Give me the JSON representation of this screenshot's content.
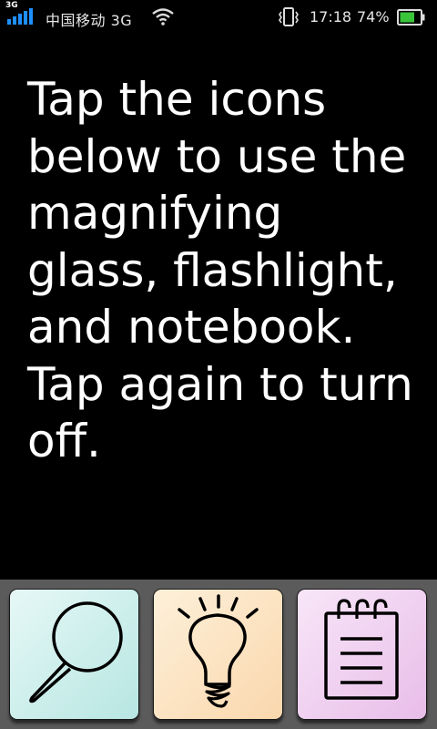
{
  "status_bar": {
    "network_type_badge": "3G",
    "carrier": "中国移动 3G",
    "time": "17:18",
    "battery_percent": "74%",
    "battery_level": 0.74,
    "accent_color": "#1e90ff",
    "icons": [
      "signal-icon",
      "wifi-icon",
      "vibrate-icon",
      "battery-icon"
    ]
  },
  "instruction": {
    "text": "Tap the icons below to use the magnifying glass, flashlight, and notebook. Tap again to turn off."
  },
  "tools": [
    {
      "name": "magnifier",
      "icon": "magnifying-glass-icon",
      "color": "#c8eeeb"
    },
    {
      "name": "flashlight",
      "icon": "light-bulb-icon",
      "color": "#fbe2c2"
    },
    {
      "name": "notebook",
      "icon": "notepad-icon",
      "color": "#efcff0"
    }
  ]
}
